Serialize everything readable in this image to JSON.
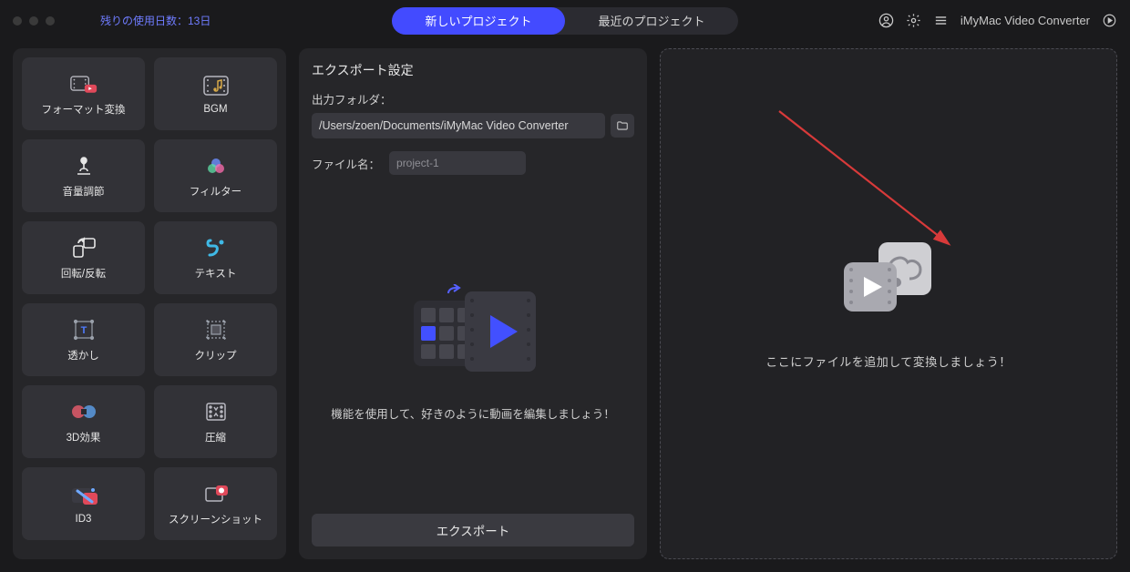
{
  "header": {
    "trial_label": "残りの使用日数：13日",
    "tab_new": "新しいプロジェクト",
    "tab_recent": "最近のプロジェクト",
    "app_name": "iMyMac Video Converter"
  },
  "tools": [
    {
      "id": "format-convert",
      "label": "フォーマット変換"
    },
    {
      "id": "bgm",
      "label": "BGM"
    },
    {
      "id": "volume",
      "label": "音量調節"
    },
    {
      "id": "filter",
      "label": "フィルター"
    },
    {
      "id": "rotate",
      "label": "回転/反転"
    },
    {
      "id": "text",
      "label": "テキスト"
    },
    {
      "id": "watermark",
      "label": "透かし"
    },
    {
      "id": "clip",
      "label": "クリップ"
    },
    {
      "id": "3d",
      "label": "3D効果"
    },
    {
      "id": "compress",
      "label": "圧縮"
    },
    {
      "id": "id3",
      "label": "ID3"
    },
    {
      "id": "screenshot",
      "label": "スクリーンショット"
    }
  ],
  "export": {
    "title": "エクスポート設定",
    "folder_label": "出力フォルダ：",
    "folder_path": "/Users/zoen/Documents/iMyMac Video Converter",
    "filename_label": "ファイル名：",
    "filename_value": "project-1",
    "preview_text": "機能を使用して、好きのように動画を編集しましょう！",
    "button_label": "エクスポート"
  },
  "dropzone": {
    "text": "ここにファイルを追加して変換しましょう！"
  },
  "icons": {
    "user": "user-icon",
    "settings": "gear-icon",
    "menu": "menu-icon",
    "play": "play-icon"
  }
}
